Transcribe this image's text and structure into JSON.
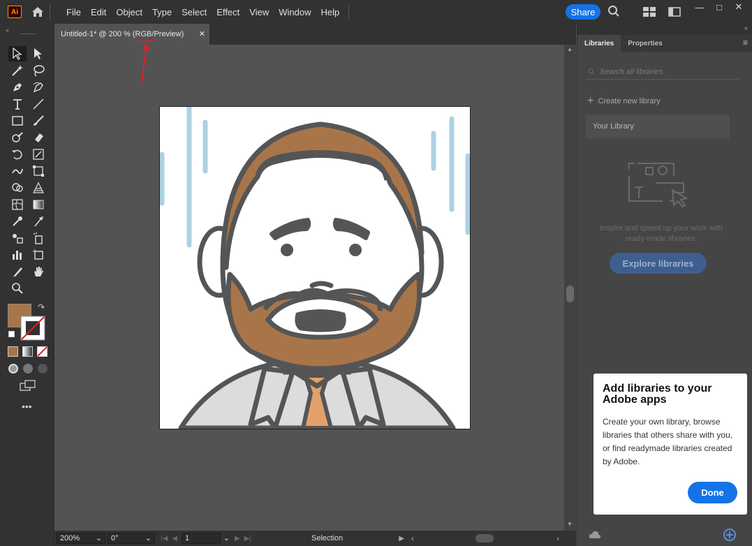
{
  "app": {
    "logo": "Ai"
  },
  "menu": [
    "File",
    "Edit",
    "Object",
    "Type",
    "Select",
    "Effect",
    "View",
    "Window",
    "Help"
  ],
  "toolbar_top": {
    "share": "Share"
  },
  "document": {
    "tab_title": "Untitled-1* @ 200 % (RGB/Preview)"
  },
  "status": {
    "zoom": "200%",
    "rotation": "0°",
    "artboard": "1",
    "tool": "Selection"
  },
  "panel": {
    "tabs": [
      "Libraries",
      "Properties"
    ],
    "search_placeholder": "Search all libraries",
    "create_new": "Create new library",
    "your_library": "Your Library",
    "inspire": "Inspire and speed up your work with ready-made libraries.",
    "explore": "Explore libraries"
  },
  "tip": {
    "title": "Add libraries to your Adobe apps",
    "body": "Create your own library, browse libraries that others share with you, or find readymade libraries created by Adobe.",
    "done": "Done"
  },
  "colors": {
    "fill": "#a8754a",
    "accent": "#1473e6",
    "annotation": "#e0202a"
  }
}
